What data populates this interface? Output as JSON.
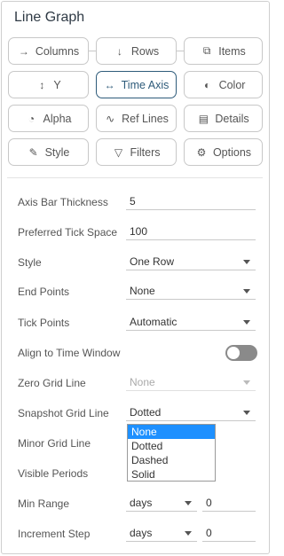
{
  "panel": {
    "title": "Line Graph"
  },
  "tabs": [
    {
      "label": "Columns",
      "icon": "→"
    },
    {
      "label": "Rows",
      "icon": "↓"
    },
    {
      "label": "Items",
      "icon": "⧉"
    },
    {
      "label": "Y",
      "icon": "↕"
    },
    {
      "label": "Time Axis",
      "icon": "↔"
    },
    {
      "label": "Color",
      "icon": "◐"
    },
    {
      "label": "Alpha",
      "icon": "◔"
    },
    {
      "label": "Ref Lines",
      "icon": "∿"
    },
    {
      "label": "Details",
      "icon": "▤"
    },
    {
      "label": "Style",
      "icon": "✎"
    },
    {
      "label": "Filters",
      "icon": "▽"
    },
    {
      "label": "Options",
      "icon": "⚙"
    }
  ],
  "settings": {
    "axis_bar_thickness": {
      "label": "Axis Bar Thickness",
      "value": "5"
    },
    "preferred_tick_space": {
      "label": "Preferred Tick Space",
      "value": "100"
    },
    "style": {
      "label": "Style",
      "value": "One Row"
    },
    "end_points": {
      "label": "End Points",
      "value": "None"
    },
    "tick_points": {
      "label": "Tick Points",
      "value": "Automatic"
    },
    "align_to_time_window": {
      "label": "Align to Time Window"
    },
    "zero_grid_line": {
      "label": "Zero Grid Line",
      "value": "None"
    },
    "snapshot_grid_line": {
      "label": "Snapshot Grid Line",
      "value": "Dotted"
    },
    "minor_grid_line": {
      "label": "Minor Grid Line"
    },
    "visible_periods": {
      "label": "Visible Periods"
    },
    "min_range": {
      "label": "Min Range",
      "unit": "days",
      "value": "0"
    },
    "increment_step": {
      "label": "Increment Step",
      "unit": "days",
      "value": "0"
    }
  },
  "dropdown": {
    "options": [
      "None",
      "Dotted",
      "Dashed",
      "Solid"
    ],
    "selected_index": 0
  }
}
